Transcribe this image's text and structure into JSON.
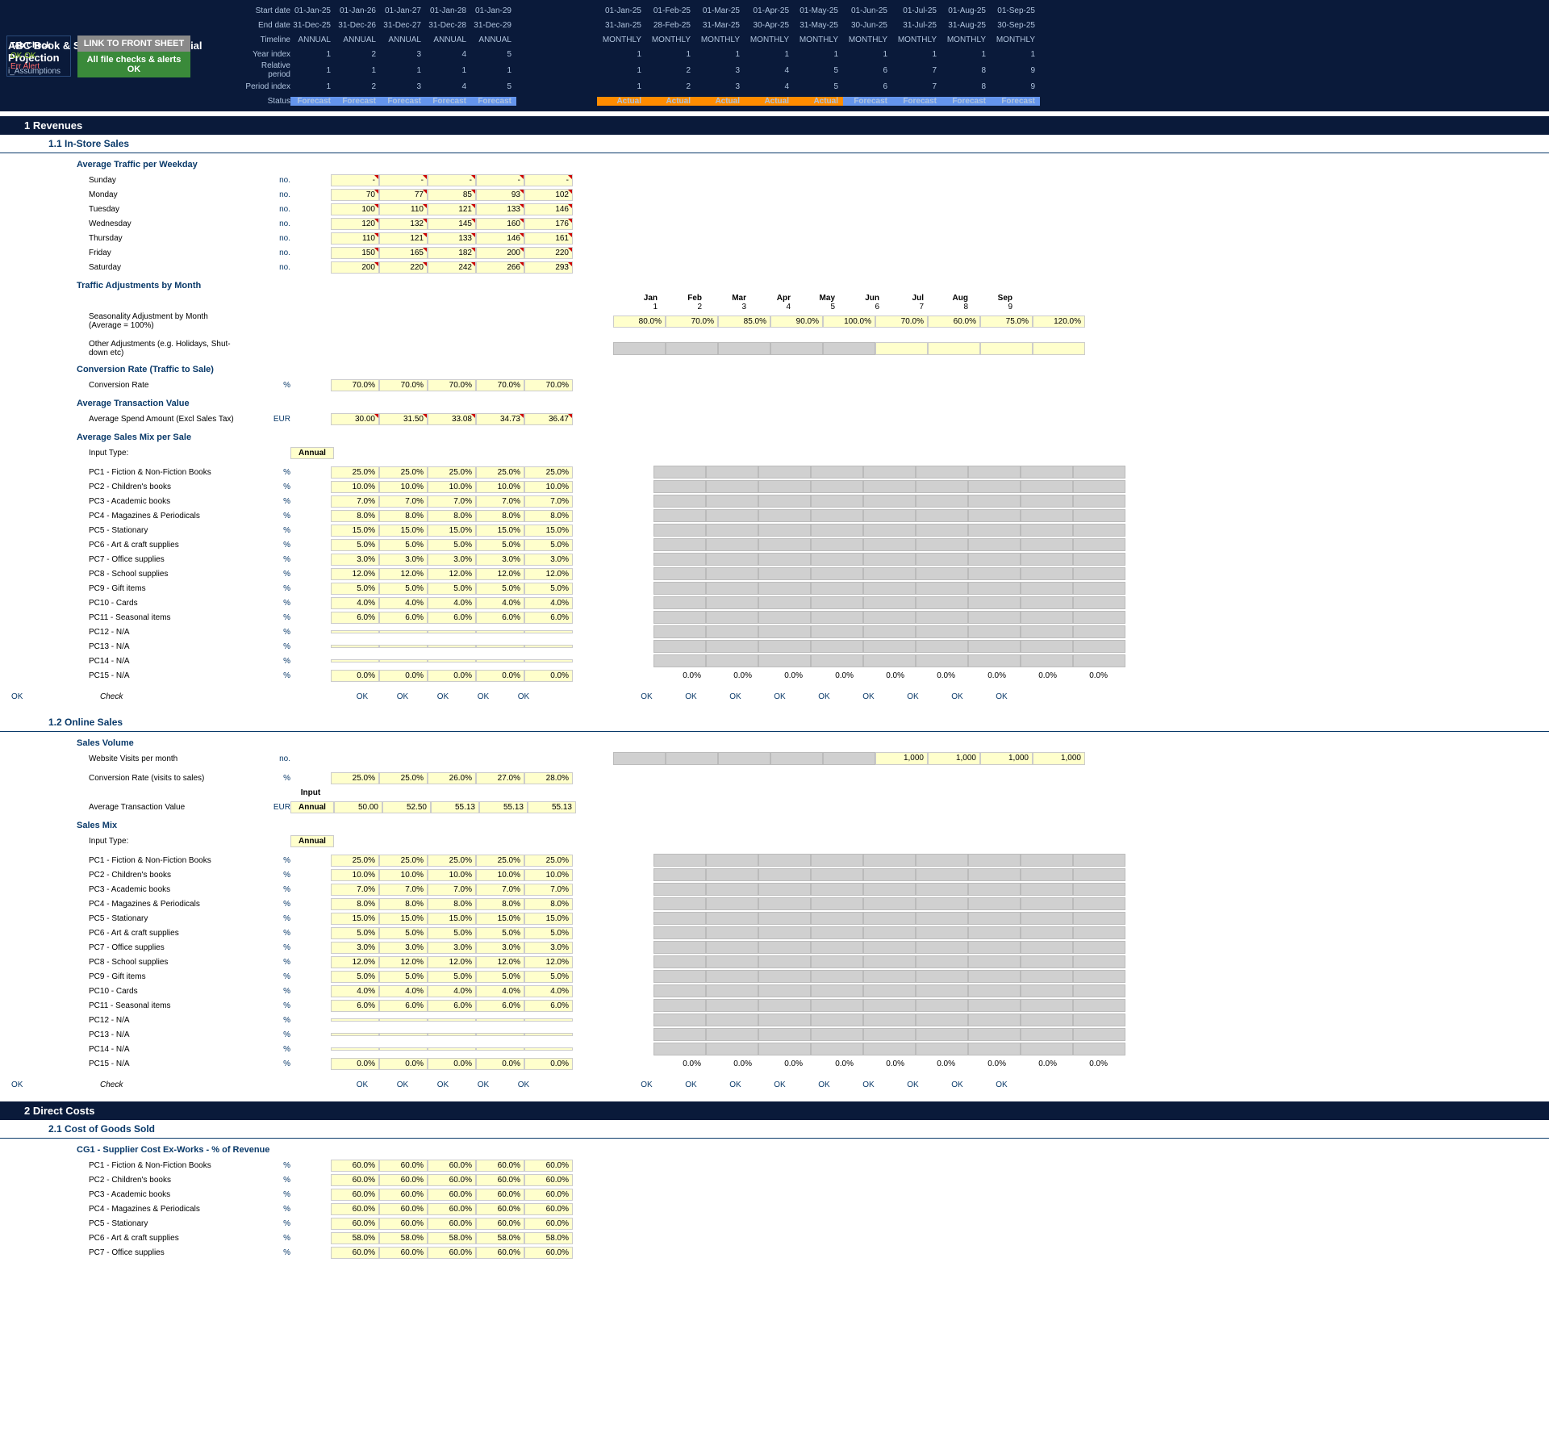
{
  "header": {
    "title": "ABC Book & Stationary Shop Financial Projection",
    "subtitle": "i_Assumptions",
    "labels": [
      "Start date",
      "End date",
      "Timeline",
      "Year index",
      "Relative period",
      "Period index",
      "Status"
    ],
    "annual": {
      "start": [
        "01-Jan-25",
        "01-Jan-26",
        "01-Jan-27",
        "01-Jan-28",
        "01-Jan-29"
      ],
      "end": [
        "31-Dec-25",
        "31-Dec-26",
        "31-Dec-27",
        "31-Dec-28",
        "31-Dec-29"
      ],
      "timeline": [
        "ANNUAL",
        "ANNUAL",
        "ANNUAL",
        "ANNUAL",
        "ANNUAL"
      ],
      "year": [
        "1",
        "2",
        "3",
        "4",
        "5"
      ],
      "rel": [
        "1",
        "1",
        "1",
        "1",
        "1"
      ],
      "period": [
        "1",
        "2",
        "3",
        "4",
        "5"
      ],
      "status": [
        "Forecast",
        "Forecast",
        "Forecast",
        "Forecast",
        "Forecast"
      ]
    },
    "monthly": {
      "start": [
        "01-Jan-25",
        "01-Feb-25",
        "01-Mar-25",
        "01-Apr-25",
        "01-May-25",
        "01-Jun-25",
        "01-Jul-25",
        "01-Aug-25",
        "01-Sep-25"
      ],
      "end": [
        "31-Jan-25",
        "28-Feb-25",
        "31-Mar-25",
        "30-Apr-25",
        "31-May-25",
        "30-Jun-25",
        "31-Jul-25",
        "31-Aug-25",
        "30-Sep-25"
      ],
      "timeline": [
        "MONTHLY",
        "MONTHLY",
        "MONTHLY",
        "MONTHLY",
        "MONTHLY",
        "MONTHLY",
        "MONTHLY",
        "MONTHLY",
        "MONTHLY"
      ],
      "year": [
        "1",
        "1",
        "1",
        "1",
        "1",
        "1",
        "1",
        "1",
        "1"
      ],
      "rel": [
        "1",
        "2",
        "3",
        "4",
        "5",
        "6",
        "7",
        "8",
        "9"
      ],
      "period": [
        "1",
        "2",
        "3",
        "4",
        "5",
        "6",
        "7",
        "8",
        "9"
      ],
      "status": [
        "Actual",
        "Actual",
        "Actual",
        "Actual",
        "Actual",
        "Forecast",
        "Forecast",
        "Forecast",
        "Forecast"
      ]
    },
    "tabcheck": {
      "title": "Tab Check",
      "ok": "OK  OK",
      "err": "Err   Alert"
    },
    "btn1": "LINK TO FRONT SHEET",
    "btn2": "All file checks & alerts OK"
  },
  "sections": {
    "s1": "1    Revenues",
    "s11": "1.1   In-Store Sales",
    "s12": "1.2   Online Sales",
    "s2": "2    Direct Costs",
    "s21": "2.1   Cost of Goods Sold"
  },
  "g": {
    "traffic": "Average Traffic per Weekday",
    "adj": "Traffic Adjustments by Month",
    "conv": "Conversion Rate (Traffic to Sale)",
    "atv": "Average Transaction Value",
    "mix": "Average Sales Mix per Sale",
    "vol": "Sales Volume",
    "mix2": "Sales Mix",
    "cg1": "CG1 - Supplier Cost Ex-Works - % of Revenue"
  },
  "days": [
    "Sunday",
    "Monday",
    "Tuesday",
    "Wednesday",
    "Thursday",
    "Friday",
    "Saturday"
  ],
  "traffic": [
    [
      "-",
      "-",
      "-",
      "-",
      "-"
    ],
    [
      "70",
      "77",
      "85",
      "93",
      "102"
    ],
    [
      "100",
      "110",
      "121",
      "133",
      "146"
    ],
    [
      "120",
      "132",
      "145",
      "160",
      "176"
    ],
    [
      "110",
      "121",
      "133",
      "146",
      "161"
    ],
    [
      "150",
      "165",
      "182",
      "200",
      "220"
    ],
    [
      "200",
      "220",
      "242",
      "266",
      "293"
    ]
  ],
  "months": [
    "Jan",
    "Feb",
    "Mar",
    "Apr",
    "May",
    "Jun",
    "Jul",
    "Aug",
    "Sep"
  ],
  "monthnum": [
    "1",
    "2",
    "3",
    "4",
    "5",
    "6",
    "7",
    "8",
    "9"
  ],
  "season_lbl": "Seasonality Adjustment by Month  (Average = 100%)",
  "season": [
    "80.0%",
    "70.0%",
    "85.0%",
    "90.0%",
    "100.0%",
    "70.0%",
    "60.0%",
    "75.0%",
    "120.0%"
  ],
  "other_lbl": "Other Adjustments (e.g. Holidays, Shut-down etc)",
  "conv_lbl": "Conversion Rate",
  "conv": [
    "70.0%",
    "70.0%",
    "70.0%",
    "70.0%",
    "70.0%"
  ],
  "atv_lbl": "Average Spend Amount (Excl Sales Tax)",
  "atv": [
    "30.00",
    "31.50",
    "33.08",
    "34.73",
    "36.47"
  ],
  "input_lbl": "Input Type:",
  "annual_tag": "Annual",
  "input_tag": "Input",
  "pc": [
    "PC1 - Fiction & Non-Fiction Books",
    "PC2 - Children's books",
    "PC3 - Academic books",
    "PC4 - Magazines & Periodicals",
    "PC5 - Stationary",
    "PC6 - Art & craft supplies",
    "PC7 - Office supplies",
    "PC8 - School supplies",
    "PC9 - Gift items",
    "PC10 - Cards",
    "PC11 - Seasonal items",
    "PC12 - N/A",
    "PC13 - N/A",
    "PC14 - N/A",
    "PC15 - N/A"
  ],
  "mix": [
    [
      "25.0%",
      "25.0%",
      "25.0%",
      "25.0%",
      "25.0%"
    ],
    [
      "10.0%",
      "10.0%",
      "10.0%",
      "10.0%",
      "10.0%"
    ],
    [
      "7.0%",
      "7.0%",
      "7.0%",
      "7.0%",
      "7.0%"
    ],
    [
      "8.0%",
      "8.0%",
      "8.0%",
      "8.0%",
      "8.0%"
    ],
    [
      "15.0%",
      "15.0%",
      "15.0%",
      "15.0%",
      "15.0%"
    ],
    [
      "5.0%",
      "5.0%",
      "5.0%",
      "5.0%",
      "5.0%"
    ],
    [
      "3.0%",
      "3.0%",
      "3.0%",
      "3.0%",
      "3.0%"
    ],
    [
      "12.0%",
      "12.0%",
      "12.0%",
      "12.0%",
      "12.0%"
    ],
    [
      "5.0%",
      "5.0%",
      "5.0%",
      "5.0%",
      "5.0%"
    ],
    [
      "4.0%",
      "4.0%",
      "4.0%",
      "4.0%",
      "4.0%"
    ],
    [
      "6.0%",
      "6.0%",
      "6.0%",
      "6.0%",
      "6.0%"
    ],
    [
      "",
      "",
      "",
      "",
      ""
    ],
    [
      "",
      "",
      "",
      "",
      ""
    ],
    [
      "",
      "",
      "",
      "",
      ""
    ],
    [
      "0.0%",
      "0.0%",
      "0.0%",
      "0.0%",
      "0.0%"
    ]
  ],
  "mix_m": [
    "0.0%",
    "0.0%",
    "0.0%",
    "0.0%",
    "0.0%",
    "0.0%",
    "0.0%",
    "0.0%",
    "0.0%"
  ],
  "ok": "OK",
  "check": "Check",
  "visits_lbl": "Website Visits per month",
  "visits": [
    "",
    "",
    "",
    "",
    "",
    "1,000",
    "1,000",
    "1,000",
    "1,000"
  ],
  "oconv_lbl": "Conversion Rate (visits to sales)",
  "oconv": [
    "25.0%",
    "25.0%",
    "26.0%",
    "27.0%",
    "28.0%"
  ],
  "oatv_lbl": "Average Transaction Value",
  "oatv": [
    "50.00",
    "52.50",
    "55.13",
    "55.13",
    "55.13"
  ],
  "cogs": [
    [
      "60.0%",
      "60.0%",
      "60.0%",
      "60.0%",
      "60.0%"
    ],
    [
      "60.0%",
      "60.0%",
      "60.0%",
      "60.0%",
      "60.0%"
    ],
    [
      "60.0%",
      "60.0%",
      "60.0%",
      "60.0%",
      "60.0%"
    ],
    [
      "60.0%",
      "60.0%",
      "60.0%",
      "60.0%",
      "60.0%"
    ],
    [
      "60.0%",
      "60.0%",
      "60.0%",
      "60.0%",
      "60.0%"
    ],
    [
      "58.0%",
      "58.0%",
      "58.0%",
      "58.0%",
      "58.0%"
    ],
    [
      "60.0%",
      "60.0%",
      "60.0%",
      "60.0%",
      "60.0%"
    ]
  ],
  "unit": {
    "no": "no.",
    "pct": "%",
    "eur": "EUR"
  }
}
